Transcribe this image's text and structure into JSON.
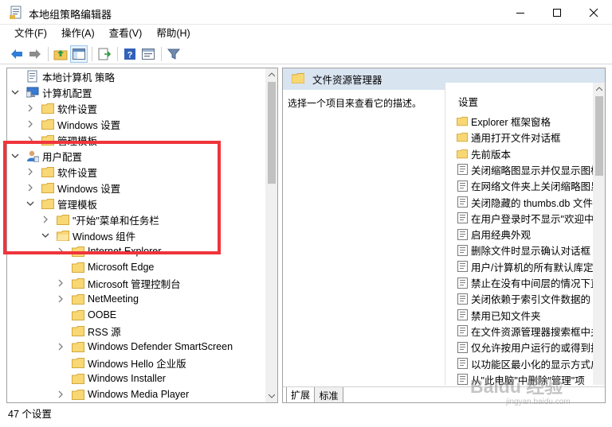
{
  "window": {
    "title": "本地组策略编辑器"
  },
  "menu": [
    "文件(F)",
    "操作(A)",
    "查看(V)",
    "帮助(H)"
  ],
  "tree": {
    "nodes": [
      {
        "label": "本地计算机 策略",
        "icon": "computer-policy-icon",
        "expander": "none"
      },
      {
        "label": "计算机配置",
        "icon": "computer-config-icon",
        "expander": "expanded"
      },
      {
        "label": "软件设置",
        "icon": "folder-icon",
        "expander": "collapsed"
      },
      {
        "label": "Windows 设置",
        "icon": "folder-icon",
        "expander": "collapsed"
      },
      {
        "label": "管理模板",
        "icon": "folder-icon",
        "expander": "collapsed"
      },
      {
        "label": "用户配置",
        "icon": "user-config-icon",
        "expander": "expanded"
      },
      {
        "label": "软件设置",
        "icon": "folder-icon",
        "expander": "collapsed"
      },
      {
        "label": "Windows 设置",
        "icon": "folder-icon",
        "expander": "collapsed"
      },
      {
        "label": "管理模板",
        "icon": "folder-icon",
        "expander": "expanded"
      },
      {
        "label": "\"开始\"菜单和任务栏",
        "icon": "folder-icon",
        "expander": "collapsed"
      },
      {
        "label": "Windows 组件",
        "icon": "folder-open-icon",
        "expander": "expanded"
      },
      {
        "label": "Internet Explorer",
        "icon": "folder-icon",
        "expander": "collapsed"
      },
      {
        "label": "Microsoft Edge",
        "icon": "folder-icon",
        "expander": "none"
      },
      {
        "label": "Microsoft 管理控制台",
        "icon": "folder-icon",
        "expander": "collapsed"
      },
      {
        "label": "NetMeeting",
        "icon": "folder-icon",
        "expander": "collapsed"
      },
      {
        "label": "OOBE",
        "icon": "folder-icon",
        "expander": "none"
      },
      {
        "label": "RSS 源",
        "icon": "folder-icon",
        "expander": "none"
      },
      {
        "label": "Windows Defender SmartScreen",
        "icon": "folder-icon",
        "expander": "collapsed"
      },
      {
        "label": "Windows Hello 企业版",
        "icon": "folder-icon",
        "expander": "none"
      },
      {
        "label": "Windows Installer",
        "icon": "folder-icon",
        "expander": "none"
      },
      {
        "label": "Windows Media Player",
        "icon": "folder-icon",
        "expander": "collapsed"
      }
    ]
  },
  "right": {
    "header_title": "文件资源管理器",
    "description": "选择一个项目来查看它的描述。",
    "settings_header": "设置",
    "settings": [
      {
        "label": "Explorer 框架窗格",
        "icon": "folder-icon"
      },
      {
        "label": "通用打开文件对话框",
        "icon": "folder-icon"
      },
      {
        "label": "先前版本",
        "icon": "folder-icon"
      },
      {
        "label": "关闭缩略图显示并仅显示图标",
        "icon": "policy-setting-icon"
      },
      {
        "label": "在网络文件夹上关闭缩略图显示",
        "icon": "policy-setting-icon"
      },
      {
        "label": "关闭隐藏的 thumbs.db 文件中的",
        "icon": "policy-setting-icon"
      },
      {
        "label": "在用户登录时不显示\"欢迎中心\"",
        "icon": "policy-setting-icon"
      },
      {
        "label": "启用经典外观",
        "icon": "policy-setting-icon"
      },
      {
        "label": "删除文件时显示确认对话框",
        "icon": "policy-setting-icon"
      },
      {
        "label": "用户/计算机的所有默认库定义的位置",
        "icon": "policy-setting-icon"
      },
      {
        "label": "禁止在没有中间层的情况下直接",
        "icon": "policy-setting-icon"
      },
      {
        "label": "关闭依赖于索引文件数据的 Windows",
        "icon": "policy-setting-icon"
      },
      {
        "label": "禁用已知文件夹",
        "icon": "policy-setting-icon"
      },
      {
        "label": "在文件资源管理器搜索框中关闭",
        "icon": "policy-setting-icon"
      },
      {
        "label": "仅允许按用户运行的或得到批准",
        "icon": "policy-setting-icon"
      },
      {
        "label": "以功能区最小化的显示方式启动",
        "icon": "policy-setting-icon"
      },
      {
        "label": "从\"此电脑\"中删除\"管理\"项",
        "icon": "policy-setting-icon"
      }
    ],
    "tabs": [
      "扩展",
      "标准"
    ]
  },
  "status": {
    "text": "47 个设置"
  },
  "watermark": {
    "brand": "Baidu 经验",
    "url": "jingyan.baidu.com"
  },
  "colors": {
    "header_bg": "#d9e4f1",
    "highlight_box": "#f0343b",
    "folder": "#f8d775"
  }
}
